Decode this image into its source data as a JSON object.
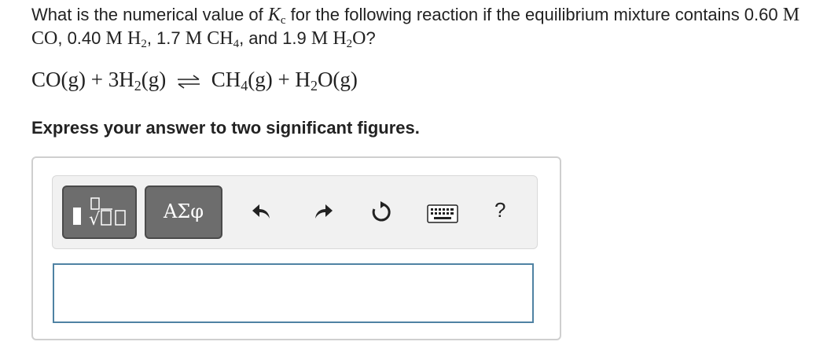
{
  "question": {
    "part1": "What is the numerical value of",
    "k_symbol": "K",
    "k_subscript": "c",
    "part2": "for the following reaction if the equilibrium mixture contains 0.60",
    "unit_m": "M",
    "co": "CO",
    "sep_after_co": ", 0.40",
    "h2_base": "H",
    "h2_sub": "2",
    "sep_after_h2": ", 1.7",
    "ch4_base": "CH",
    "ch4_sub": "4",
    "sep_after_ch4": ", and 1.9",
    "h2o_base": "H",
    "h2o_sub": "2",
    "h2o_end": "O",
    "question_mark": "?"
  },
  "equation": {
    "left_co": "CO(g) + 3H",
    "left_sub": "2",
    "left_end": "(g)",
    "right_ch": "CH",
    "right_sub4": "4",
    "right_mid": "(g) + H",
    "right_sub2": "2",
    "right_end": "O(g)"
  },
  "instruction": "Express your answer to two significant figures.",
  "toolbar": {
    "symbols_label": "ΑΣφ",
    "help_label": "?"
  },
  "answer": {
    "value": ""
  },
  "colors": {
    "toolbar_button": "#6d6d6d",
    "input_border": "#4f82a3"
  }
}
